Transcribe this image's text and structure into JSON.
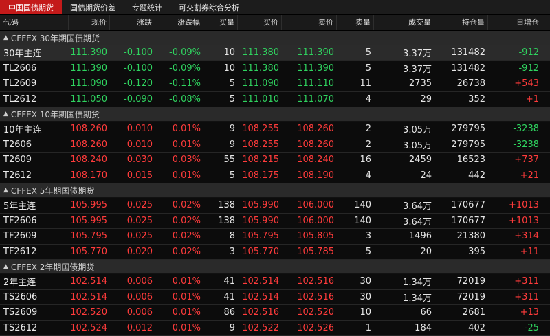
{
  "colors": {
    "up": "#ff3b3b",
    "down": "#2fd35f",
    "tab_active": "#c41a1a"
  },
  "tabs": [
    "中国国债期货",
    "国债期货价差",
    "专题统计",
    "可交割券综合分析"
  ],
  "columns": [
    "代码",
    "现价",
    "涨跌",
    "涨跌幅",
    "买量",
    "买价",
    "卖价",
    "卖量",
    "成交量",
    "持仓量",
    "日增仓"
  ],
  "groups": [
    {
      "title": "CFFEX 30年期国债期货",
      "dir": "dn",
      "rows": [
        {
          "code": "30年主连",
          "price": "111.390",
          "chg": "-0.100",
          "pct": "-0.09%",
          "bidv": "10",
          "bid": "111.380",
          "ask": "111.390",
          "askv": "5",
          "vol": "3.37万",
          "oi": "131482",
          "doi": "-912",
          "doi_dir": "dn"
        },
        {
          "code": "TL2606",
          "price": "111.390",
          "chg": "-0.100",
          "pct": "-0.09%",
          "bidv": "10",
          "bid": "111.380",
          "ask": "111.390",
          "askv": "5",
          "vol": "3.37万",
          "oi": "131482",
          "doi": "-912",
          "doi_dir": "dn"
        },
        {
          "code": "TL2609",
          "price": "111.090",
          "chg": "-0.120",
          "pct": "-0.11%",
          "bidv": "5",
          "bid": "111.090",
          "ask": "111.110",
          "askv": "11",
          "vol": "2735",
          "oi": "26738",
          "doi": "+543",
          "doi_dir": "up"
        },
        {
          "code": "TL2612",
          "price": "111.050",
          "chg": "-0.090",
          "pct": "-0.08%",
          "bidv": "5",
          "bid": "111.010",
          "ask": "111.070",
          "askv": "4",
          "vol": "29",
          "oi": "352",
          "doi": "+1",
          "doi_dir": "up"
        }
      ]
    },
    {
      "title": "CFFEX 10年期国债期货",
      "dir": "up",
      "rows": [
        {
          "code": "10年主连",
          "price": "108.260",
          "chg": "0.010",
          "pct": "0.01%",
          "bidv": "9",
          "bid": "108.255",
          "ask": "108.260",
          "askv": "2",
          "vol": "3.05万",
          "oi": "279795",
          "doi": "-3238",
          "doi_dir": "dn"
        },
        {
          "code": "T2606",
          "price": "108.260",
          "chg": "0.010",
          "pct": "0.01%",
          "bidv": "9",
          "bid": "108.255",
          "ask": "108.260",
          "askv": "2",
          "vol": "3.05万",
          "oi": "279795",
          "doi": "-3238",
          "doi_dir": "dn"
        },
        {
          "code": "T2609",
          "price": "108.240",
          "chg": "0.030",
          "pct": "0.03%",
          "bidv": "55",
          "bid": "108.215",
          "ask": "108.240",
          "askv": "16",
          "vol": "2459",
          "oi": "16523",
          "doi": "+737",
          "doi_dir": "up"
        },
        {
          "code": "T2612",
          "price": "108.170",
          "chg": "0.015",
          "pct": "0.01%",
          "bidv": "5",
          "bid": "108.175",
          "ask": "108.190",
          "askv": "4",
          "vol": "24",
          "oi": "442",
          "doi": "+21",
          "doi_dir": "up"
        }
      ]
    },
    {
      "title": "CFFEX 5年期国债期货",
      "dir": "up",
      "rows": [
        {
          "code": "5年主连",
          "price": "105.995",
          "chg": "0.025",
          "pct": "0.02%",
          "bidv": "138",
          "bid": "105.990",
          "ask": "106.000",
          "askv": "140",
          "vol": "3.64万",
          "oi": "170677",
          "doi": "+1013",
          "doi_dir": "up"
        },
        {
          "code": "TF2606",
          "price": "105.995",
          "chg": "0.025",
          "pct": "0.02%",
          "bidv": "138",
          "bid": "105.990",
          "ask": "106.000",
          "askv": "140",
          "vol": "3.64万",
          "oi": "170677",
          "doi": "+1013",
          "doi_dir": "up"
        },
        {
          "code": "TF2609",
          "price": "105.795",
          "chg": "0.025",
          "pct": "0.02%",
          "bidv": "8",
          "bid": "105.795",
          "ask": "105.805",
          "askv": "3",
          "vol": "1496",
          "oi": "21380",
          "doi": "+314",
          "doi_dir": "up"
        },
        {
          "code": "TF2612",
          "price": "105.770",
          "chg": "0.020",
          "pct": "0.02%",
          "bidv": "3",
          "bid": "105.770",
          "ask": "105.785",
          "askv": "5",
          "vol": "20",
          "oi": "395",
          "doi": "+11",
          "doi_dir": "up"
        }
      ]
    },
    {
      "title": "CFFEX 2年期国债期货",
      "dir": "up",
      "rows": [
        {
          "code": "2年主连",
          "price": "102.514",
          "chg": "0.006",
          "pct": "0.01%",
          "bidv": "41",
          "bid": "102.514",
          "ask": "102.516",
          "askv": "30",
          "vol": "1.34万",
          "oi": "72019",
          "doi": "+311",
          "doi_dir": "up"
        },
        {
          "code": "TS2606",
          "price": "102.514",
          "chg": "0.006",
          "pct": "0.01%",
          "bidv": "41",
          "bid": "102.514",
          "ask": "102.516",
          "askv": "30",
          "vol": "1.34万",
          "oi": "72019",
          "doi": "+311",
          "doi_dir": "up"
        },
        {
          "code": "TS2609",
          "price": "102.520",
          "chg": "0.006",
          "pct": "0.01%",
          "bidv": "86",
          "bid": "102.516",
          "ask": "102.520",
          "askv": "10",
          "vol": "66",
          "oi": "2681",
          "doi": "+13",
          "doi_dir": "up"
        },
        {
          "code": "TS2612",
          "price": "102.524",
          "chg": "0.012",
          "pct": "0.01%",
          "bidv": "9",
          "bid": "102.522",
          "ask": "102.526",
          "askv": "1",
          "vol": "184",
          "oi": "402",
          "doi": "-25",
          "doi_dir": "dn"
        }
      ]
    }
  ]
}
